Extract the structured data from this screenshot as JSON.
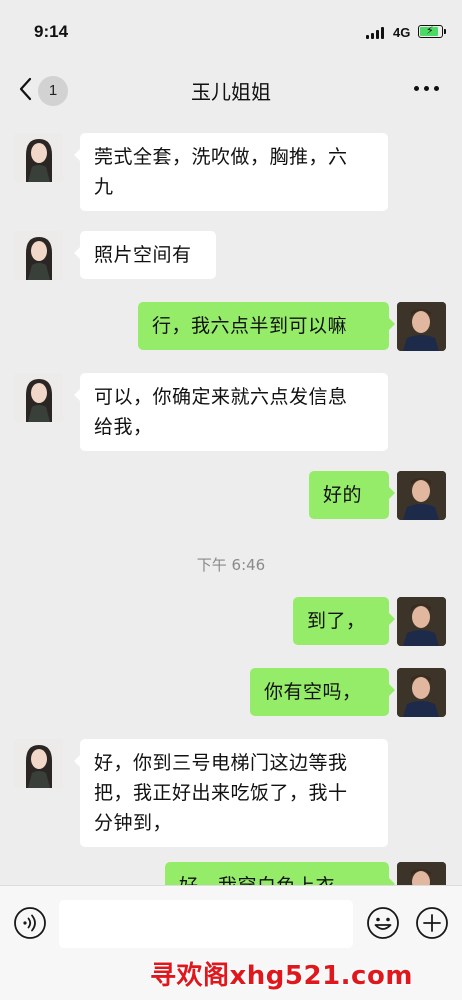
{
  "status_bar": {
    "time": "9:14",
    "network": "4G",
    "battery_charging": true,
    "battery_level": 0.8
  },
  "nav": {
    "unread_count": "1",
    "title": "玉儿姐姐",
    "back_icon": "chevron-left-icon",
    "more_icon": "more-dots-icon"
  },
  "messages": [
    {
      "from": "contact",
      "text_lines": [
        "莞式全套，洗吹做，胸推，六",
        "九"
      ]
    },
    {
      "from": "contact",
      "text_lines": [
        "照片空间有"
      ]
    },
    {
      "from": "me",
      "text_lines": [
        "行，我六点半到可以嘛"
      ]
    },
    {
      "from": "contact",
      "text_lines": [
        "可以，你确定来就六点发信息",
        "给我，"
      ]
    },
    {
      "from": "me",
      "text_lines": [
        "好的"
      ]
    },
    {
      "from": "me",
      "text_lines": [
        "到了，"
      ]
    },
    {
      "from": "me",
      "text_lines": [
        "你有空吗，"
      ]
    },
    {
      "from": "contact",
      "text_lines": [
        "好，你到三号电梯门这边等我",
        "把，我正好出来吃饭了，我十",
        "分钟到，"
      ]
    },
    {
      "from": "me",
      "text_lines": [
        "好，我穿白色上衣"
      ]
    }
  ],
  "timestamp": "下午 6:46",
  "input_bar": {
    "voice_icon": "voice-icon",
    "emoji_icon": "emoji-icon",
    "plus_icon": "plus-icon",
    "input_value": ""
  },
  "watermark": "寻欢阁xhg521.com",
  "colors": {
    "background": "#ededed",
    "incoming_bubble": "#ffffff",
    "outgoing_bubble": "#95ec69",
    "watermark": "#e0181e"
  }
}
